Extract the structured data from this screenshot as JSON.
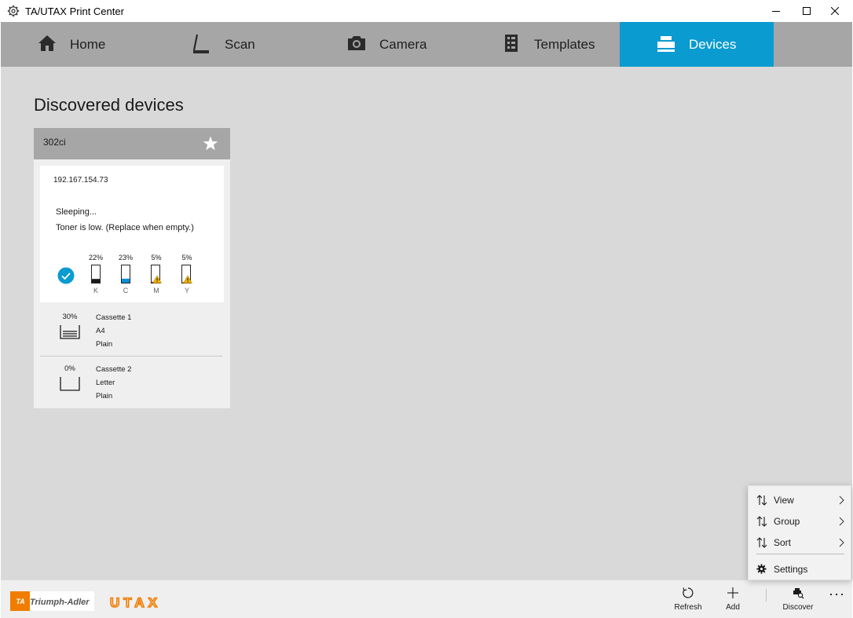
{
  "window": {
    "title": "TA/UTAX Print Center"
  },
  "nav": {
    "tabs": [
      {
        "label": "Home",
        "icon": "home-icon"
      },
      {
        "label": "Scan",
        "icon": "scan-icon"
      },
      {
        "label": "Camera",
        "icon": "camera-icon"
      },
      {
        "label": "Templates",
        "icon": "templates-icon"
      },
      {
        "label": "Devices",
        "icon": "printer-icon",
        "active": true
      }
    ]
  },
  "main": {
    "heading": "Discovered devices"
  },
  "device": {
    "name": "302ci",
    "ip": "192.167.154.73",
    "status_line1": "Sleeping...",
    "status_line2": "Toner is low. (Replace when empty.)",
    "toners": [
      {
        "pct": "22%",
        "letter": "K",
        "level": 0.22,
        "color": "#1a1a1a",
        "warning": false
      },
      {
        "pct": "23%",
        "letter": "C",
        "level": 0.23,
        "color": "#0a8fd8",
        "warning": false
      },
      {
        "pct": "5%",
        "letter": "M",
        "level": 0.05,
        "color": "#d4145a",
        "warning": true
      },
      {
        "pct": "5%",
        "letter": "Y",
        "level": 0.05,
        "color": "#f2c500",
        "warning": true
      }
    ],
    "trays": [
      {
        "pct": "30%",
        "name": "Cassette 1",
        "size": "A4",
        "media": "Plain",
        "level": 0.3
      },
      {
        "pct": "0%",
        "name": "Cassette 2",
        "size": "Letter",
        "media": "Plain",
        "level": 0
      }
    ]
  },
  "footer": {
    "brand1": "Triumph-Adler",
    "brand1_mark": "TA",
    "brand2": "UTAX",
    "actions": {
      "refresh": "Refresh",
      "add": "Add",
      "discover": "Discover"
    }
  },
  "menu": {
    "items": [
      {
        "label": "View",
        "icon": "sort-arrows-icon",
        "submenu": true
      },
      {
        "label": "Group",
        "icon": "sort-arrows-icon",
        "submenu": true
      },
      {
        "label": "Sort",
        "icon": "sort-arrows-icon",
        "submenu": true
      },
      {
        "label": "Settings",
        "icon": "gear-icon",
        "submenu": false
      }
    ]
  },
  "colors": {
    "accent": "#0a9bd0",
    "nav_bg": "#a6a6a6",
    "content_bg": "#d9d9d9",
    "brand_orange": "#f07d00"
  }
}
